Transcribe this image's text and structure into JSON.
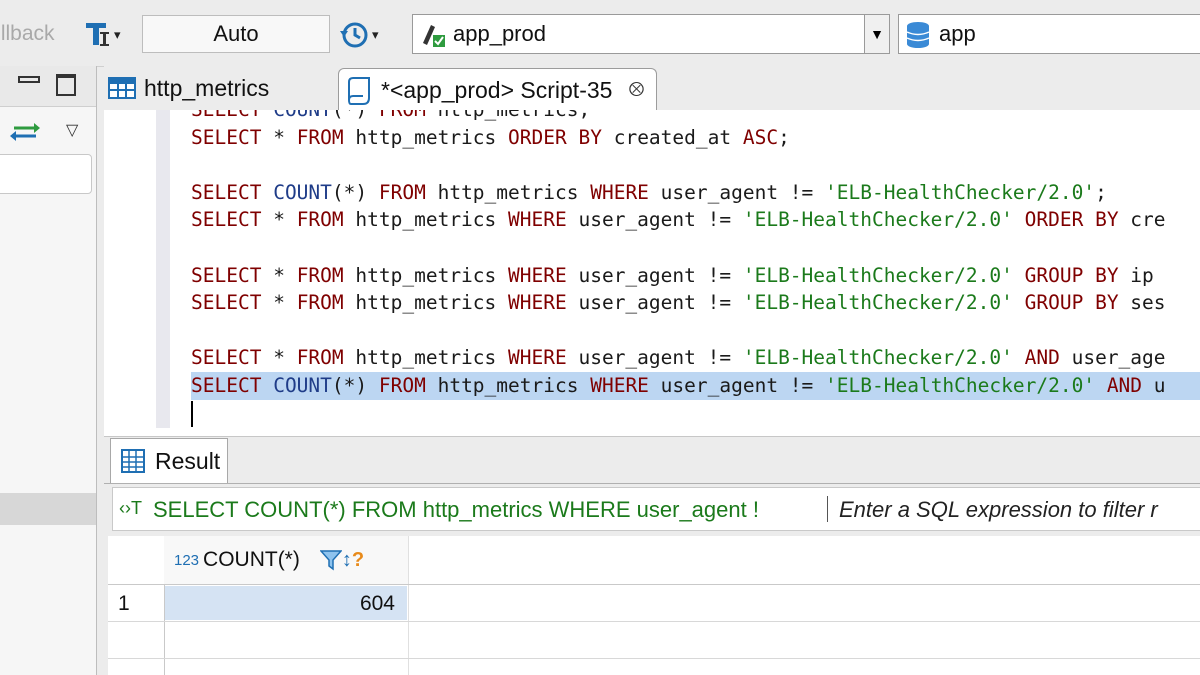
{
  "toolbar": {
    "rollback_label": "Rollback",
    "transaction_mode": "Auto",
    "connection": "app_prod",
    "database": "app"
  },
  "tabs": [
    {
      "label": "http_metrics",
      "active": false
    },
    {
      "label": "*<app_prod> Script-35",
      "active": true
    }
  ],
  "editor": {
    "lines": [
      "SELECT COUNT(*) FROM http_metrics;",
      "SELECT * FROM http_metrics ORDER BY created_at ASC;",
      "",
      "SELECT COUNT(*) FROM http_metrics WHERE user_agent != 'ELB-HealthChecker/2.0';",
      "SELECT * FROM http_metrics WHERE user_agent != 'ELB-HealthChecker/2.0' ORDER BY cre",
      "",
      "SELECT * FROM http_metrics WHERE user_agent != 'ELB-HealthChecker/2.0' GROUP BY ip",
      "SELECT * FROM http_metrics WHERE user_agent != 'ELB-HealthChecker/2.0' GROUP BY ses",
      "",
      "SELECT * FROM http_metrics WHERE user_agent != 'ELB-HealthChecker/2.0' AND user_age",
      "SELECT COUNT(*) FROM http_metrics WHERE user_agent != 'ELB-HealthChecker/2.0' AND u"
    ],
    "highlighted_line": 10
  },
  "result": {
    "tab_label": "Result",
    "query_text": "SELECT COUNT(*) FROM http_metrics WHERE user_agent !",
    "filter_placeholder": "Enter a SQL expression to filter r",
    "column": {
      "type_badge": "123",
      "name": "COUNT(*)"
    },
    "rows": [
      {
        "num": "1",
        "value": "604"
      }
    ]
  },
  "colors": {
    "keyword": "#7f0000",
    "function": "#1f3c88",
    "string": "#1b7a1b",
    "selection": "#bcd6f2"
  }
}
